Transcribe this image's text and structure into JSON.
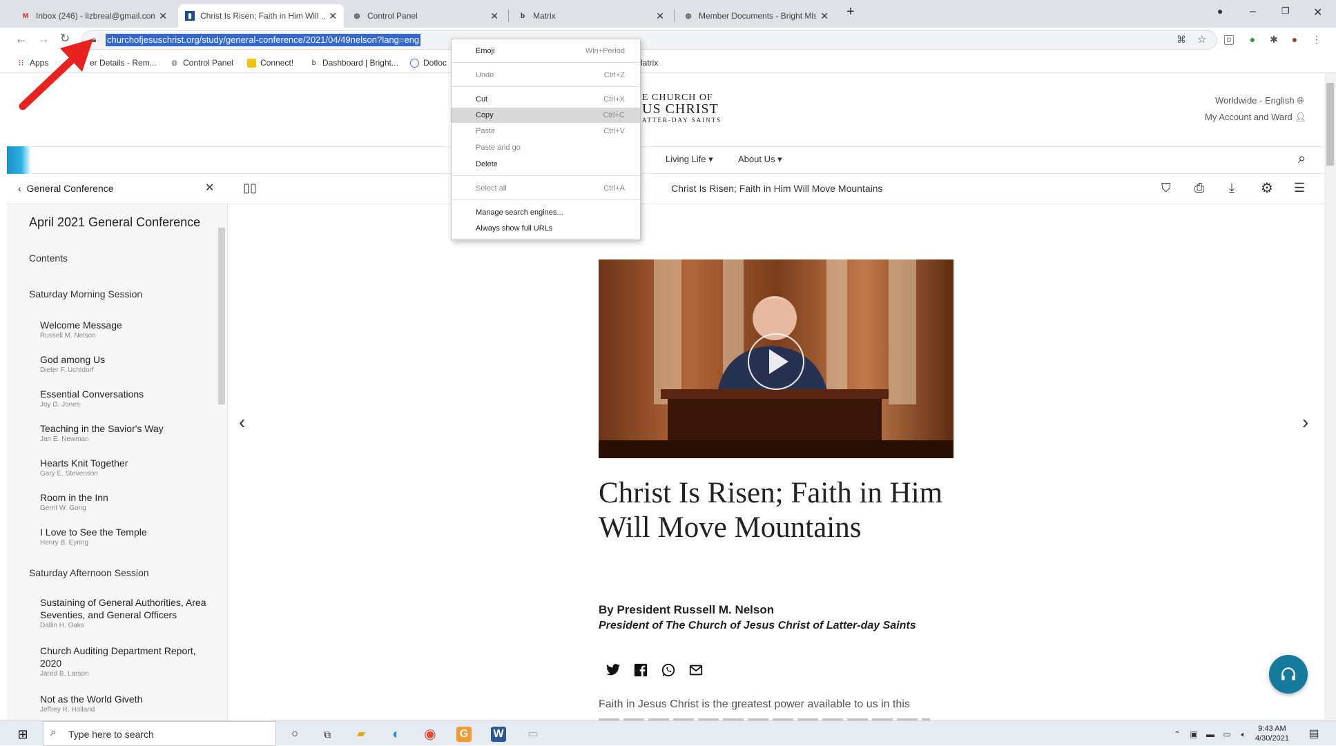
{
  "browser": {
    "tabs": [
      {
        "title": "Inbox (246) - lizbreal@gmail.com",
        "icon": "gmail-icon"
      },
      {
        "title": "Christ Is Risen; Faith in Him Will ...",
        "icon": "church-icon"
      },
      {
        "title": "Control Panel",
        "icon": "globe-icon"
      },
      {
        "title": "Matrix",
        "icon": "brightmls-icon"
      },
      {
        "title": "Member Documents - Bright Mls",
        "icon": "globe-icon"
      }
    ],
    "url": "churchofjesuschrist.org/study/general-conference/2021/04/49nelson?lang=eng",
    "bookmarks": [
      "Apps",
      "er Details - Rem...",
      "Control Panel",
      "Connect!",
      "Dashboard | Bright...",
      "Dotloc",
      "latrix"
    ]
  },
  "context_menu": {
    "items": [
      {
        "label": "Emoji",
        "shortcut": "Win+Period",
        "disabled": false
      },
      {
        "label": "Undo",
        "shortcut": "Ctrl+Z",
        "disabled": true
      },
      {
        "label": "Cut",
        "shortcut": "Ctrl+X",
        "disabled": false
      },
      {
        "label": "Copy",
        "shortcut": "Ctrl+C",
        "disabled": false,
        "highlighted": true
      },
      {
        "label": "Paste",
        "shortcut": "Ctrl+V",
        "disabled": true
      },
      {
        "label": "Paste and go",
        "shortcut": "",
        "disabled": true
      },
      {
        "label": "Delete",
        "shortcut": "",
        "disabled": false
      },
      {
        "label": "Select all",
        "shortcut": "Ctrl+A",
        "disabled": true
      },
      {
        "label": "Manage search engines...",
        "shortcut": "",
        "disabled": false
      },
      {
        "label": "Always show full URLs",
        "shortcut": "",
        "disabled": false
      }
    ]
  },
  "header": {
    "logo_line1": "E CHURCH OF",
    "logo_line2": "US CHRIST",
    "logo_line3": "ATTER-DAY SAINTS",
    "language": "Worldwide - English",
    "account": "My Account and Ward",
    "menu": [
      "Living Life",
      "About Us"
    ]
  },
  "context_bar": {
    "back_label": "General Conference",
    "doc_title": "Christ Is Risen; Faith in Him Will Move Mountains"
  },
  "sidebar": {
    "title": "April 2021 General Conference",
    "contents": "Contents",
    "sections": [
      {
        "title": "Saturday Morning Session",
        "items": [
          {
            "title": "Welcome Message",
            "author": "Russell M. Nelson"
          },
          {
            "title": "God among Us",
            "author": "Dieter F. Uchtdorf"
          },
          {
            "title": "Essential Conversations",
            "author": "Joy D. Jones"
          },
          {
            "title": "Teaching in the Savior's Way",
            "author": "Jan E. Newman"
          },
          {
            "title": "Hearts Knit Together",
            "author": "Gary E. Stevenson"
          },
          {
            "title": "Room in the Inn",
            "author": "Gerrit W. Gong"
          },
          {
            "title": "I Love to See the Temple",
            "author": "Henry B. Eyring"
          }
        ]
      },
      {
        "title": "Saturday Afternoon Session",
        "items": [
          {
            "title": "Sustaining of General Authorities, Area Seventies, and General Officers",
            "author": "Dallin H. Oaks"
          },
          {
            "title": "Church Auditing Department Report, 2020",
            "author": "Jared B. Larson"
          },
          {
            "title": "Not as the World Giveth",
            "author": "Jeffrey R. Holland"
          }
        ]
      }
    ]
  },
  "article": {
    "title": "Christ Is Risen; Faith in Him Will Move Mountains",
    "byline": "By President Russell M. Nelson",
    "role": "President of The Church of Jesus Christ of Latter-day Saints",
    "paragraph": "Faith in Jesus Christ is the greatest power available to us in this"
  },
  "taskbar": {
    "search_placeholder": "Type here to search",
    "time": "9:43 AM",
    "date": "4/30/2021"
  },
  "colors": {
    "accent_blue": "#157a9c",
    "url_highlight": "#3367d6",
    "arrow_red": "#e8231f"
  }
}
